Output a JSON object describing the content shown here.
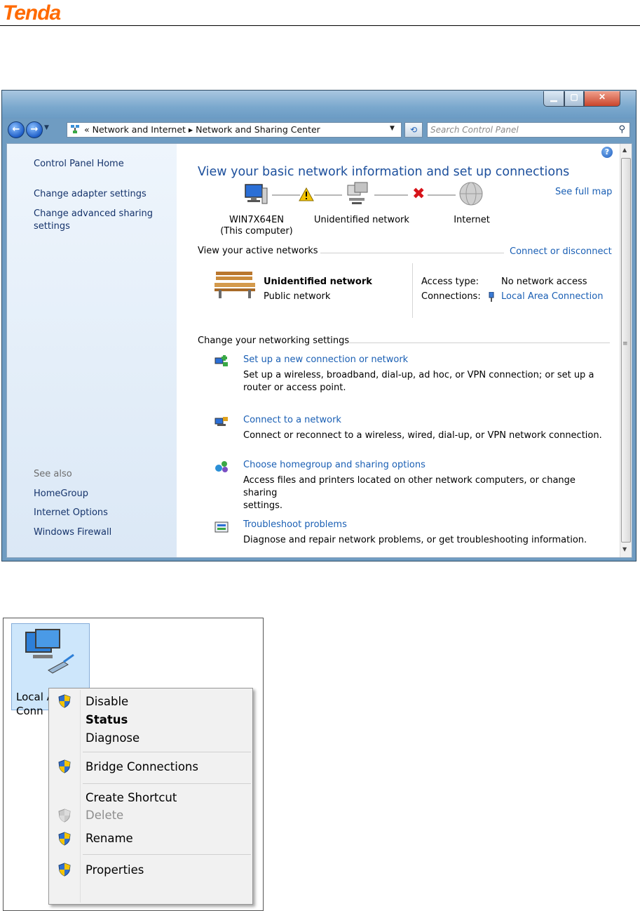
{
  "header": {
    "logo_text": "Tenda"
  },
  "window": {
    "address_path": "« Network and Internet ▸ Network and Sharing Center",
    "search_placeholder": "Search Control Panel",
    "sidebar": {
      "home": "Control Panel Home",
      "adapter": "Change adapter settings",
      "advanced_line1": "Change advanced sharing",
      "advanced_line2": "settings",
      "see_also": "See also",
      "homegroup": "HomeGroup",
      "internet_options": "Internet Options",
      "firewall": "Windows Firewall"
    },
    "main": {
      "heading": "View your basic network information and set up connections",
      "see_full_map": "See full map",
      "node_computer": "WIN7X64EN",
      "node_computer_sub": "(This computer)",
      "node_network": "Unidentified network",
      "node_internet": "Internet",
      "active_networks": "View your active networks",
      "connect_disconnect": "Connect or disconnect",
      "net_name": "Unidentified network",
      "net_type": "Public network",
      "access_type_label": "Access type:",
      "access_type_value": "No network access",
      "connections_label": "Connections:",
      "connections_value": "Local Area Connection",
      "change_settings": "Change your networking settings",
      "tasks": [
        {
          "title": "Set up a new connection or network",
          "desc1": "Set up a wireless, broadband, dial-up, ad hoc, or VPN connection; or set up a",
          "desc2": "router or access point."
        },
        {
          "title": "Connect to a network",
          "desc1": "Connect or reconnect to a wireless, wired, dial-up, or VPN network connection.",
          "desc2": ""
        },
        {
          "title": "Choose homegroup and sharing options",
          "desc1": "Access files and printers located on other network computers, or change sharing",
          "desc2": "settings."
        },
        {
          "title": "Troubleshoot problems",
          "desc1": "Diagnose and repair network problems, or get troubleshooting information.",
          "desc2": ""
        }
      ]
    }
  },
  "context_panel": {
    "tile_line1": "Local A",
    "tile_line2": "Conn",
    "menu": {
      "disable": "Disable",
      "status": "Status",
      "diagnose": "Diagnose",
      "bridge": "Bridge Connections",
      "shortcut": "Create Shortcut",
      "delete": "Delete",
      "rename": "Rename",
      "properties": "Properties"
    }
  },
  "colors": {
    "link": "#1a5fb4",
    "heading": "#1c4f9c",
    "logo": "#ff6a00",
    "warning": "#f5c400",
    "error": "#d7141a"
  }
}
